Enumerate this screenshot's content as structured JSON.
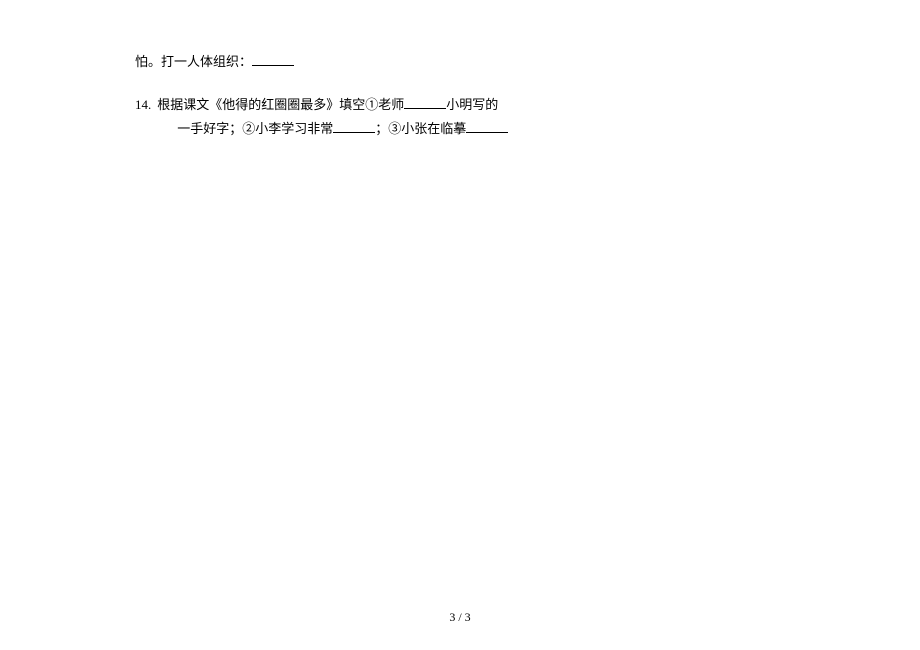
{
  "questions": {
    "fragment13": {
      "text_prefix": "怕。打一人体组织：",
      "blank": ""
    },
    "q14": {
      "number": "14.",
      "line1_prefix": "根据课文《他得的红圈圈最多》填空①老师",
      "line1_blank": "",
      "line1_suffix": "小明写的",
      "line2_prefix": "一手好字；②小李学习非常",
      "line2_blank": "",
      "line2_mid": "；③小张在临摹",
      "line2_blank2": ""
    }
  },
  "footer": {
    "page": "3 / 3"
  }
}
